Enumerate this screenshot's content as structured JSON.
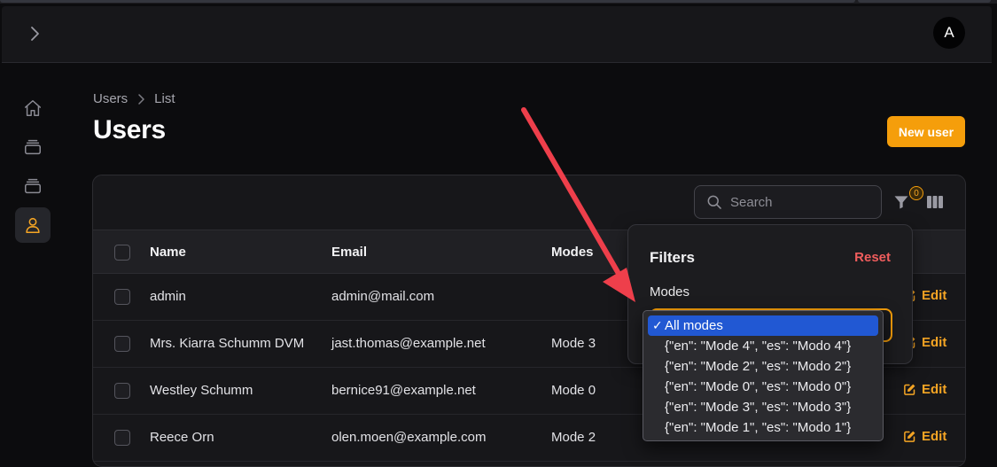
{
  "header": {
    "avatar_initial": "A"
  },
  "sidebar": {
    "items": [
      {
        "name": "home",
        "icon": "home-icon"
      },
      {
        "name": "resource-1",
        "icon": "stack-icon"
      },
      {
        "name": "resource-2",
        "icon": "stack-icon"
      },
      {
        "name": "users",
        "icon": "user-icon",
        "active": true
      }
    ]
  },
  "breadcrumb": {
    "items": [
      "Users",
      "List"
    ]
  },
  "page": {
    "title": "Users",
    "new_button": "New user"
  },
  "toolbar": {
    "search_placeholder": "Search",
    "filter_count": "0"
  },
  "table": {
    "columns": [
      "Name",
      "Email",
      "Modes"
    ],
    "edit_label": "Edit",
    "rows": [
      {
        "name": "admin",
        "email": "admin@mail.com",
        "mode": ""
      },
      {
        "name": "Mrs. Kiarra Schumm DVM",
        "email": "jast.thomas@example.net",
        "mode": "Mode 3"
      },
      {
        "name": "Westley Schumm",
        "email": "bernice91@example.net",
        "mode": "Mode 0"
      },
      {
        "name": "Reece Orn",
        "email": "olen.moen@example.com",
        "mode": "Mode 2"
      }
    ]
  },
  "filters": {
    "title": "Filters",
    "reset": "Reset",
    "modes_label": "Modes",
    "options": [
      "All modes",
      "{\"en\": \"Mode 4\", \"es\": \"Modo 4\"}",
      "{\"en\": \"Mode 2\", \"es\": \"Modo 2\"}",
      "{\"en\": \"Mode 0\", \"es\": \"Modo 0\"}",
      "{\"en\": \"Mode 3\", \"es\": \"Modo 3\"}",
      "{\"en\": \"Mode 1\", \"es\": \"Modo 1\"}"
    ],
    "selected_check": "✓"
  },
  "colors": {
    "accent": "#f59e0b",
    "danger": "#f05d5d",
    "select_highlight": "#2158d3",
    "annotation_arrow": "#ee3f4b"
  }
}
